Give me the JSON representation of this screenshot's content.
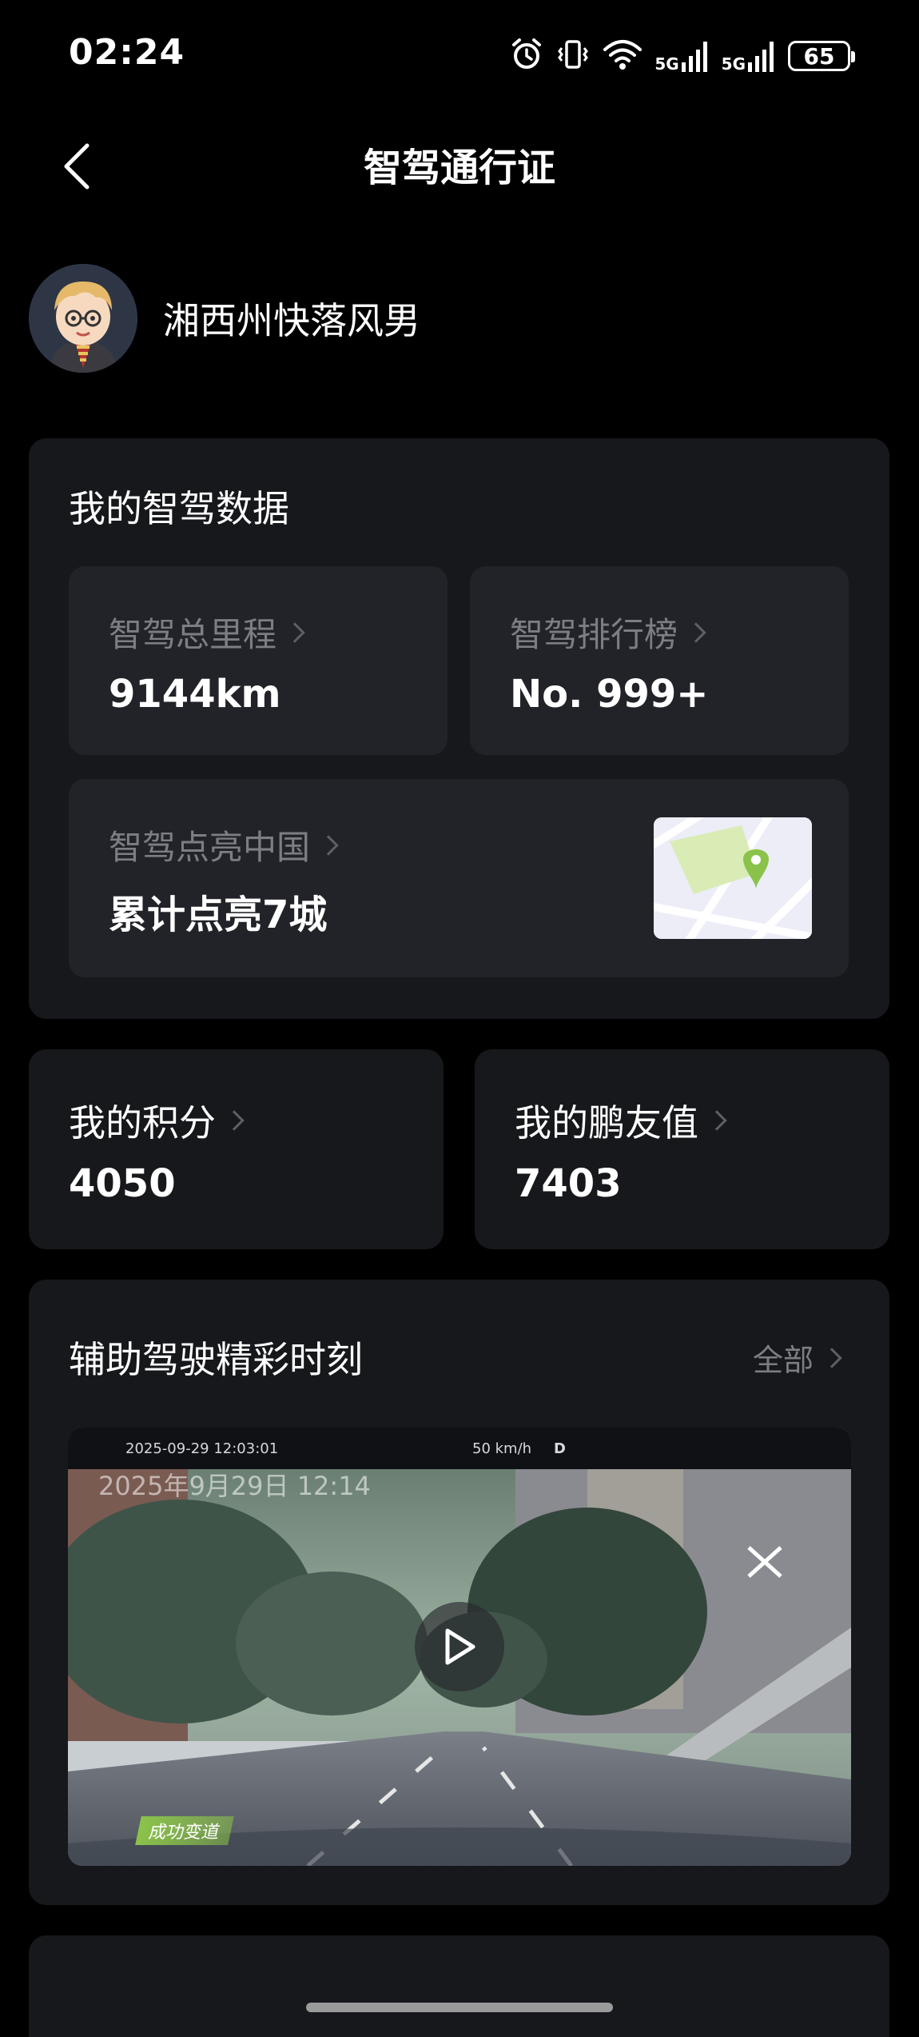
{
  "status_bar": {
    "time": "02:24",
    "battery": "65",
    "signal_1_label": "5G",
    "signal_2_label": "5G"
  },
  "nav": {
    "title": "智驾通行证"
  },
  "profile": {
    "username": "湘西州快落风男"
  },
  "driving_data": {
    "title": "我的智驾数据",
    "mileage_label": "智驾总里程",
    "mileage_value": "9144km",
    "ranking_label": "智驾排行榜",
    "ranking_value": "No. 999+",
    "cities_label": "智驾点亮中国",
    "cities_value": "累计点亮7城"
  },
  "points": {
    "label": "我的积分",
    "value": "4050"
  },
  "friend_value": {
    "label": "我的鹏友值",
    "value": "7403"
  },
  "moments": {
    "title": "辅助驾驶精彩时刻",
    "all_label": "全部",
    "video": {
      "hud_date": "2025-09-29    12:03:01",
      "hud_speed": "50   km/h",
      "hud_gear": "D",
      "stamp": "2025年9月29日 12:14",
      "tag": "成功变道"
    }
  },
  "colors": {
    "background": "#000000",
    "card": "#17181c",
    "inner_card": "#222328",
    "muted_text": "#7d7e84",
    "map_pin": "#8bc34a"
  }
}
